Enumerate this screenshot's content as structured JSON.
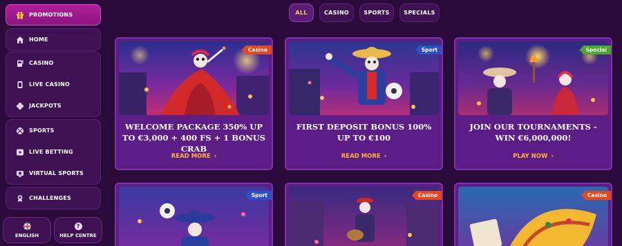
{
  "sidebar": {
    "promotions": "PROMOTIONS",
    "group1": [
      {
        "label": "HOME",
        "icon": "home-icon"
      }
    ],
    "group2": [
      {
        "label": "CASINO",
        "icon": "slot-machine-icon"
      },
      {
        "label": "LIVE CASINO",
        "icon": "card-icon"
      },
      {
        "label": "JACKPOTS",
        "icon": "clover-icon"
      }
    ],
    "group3": [
      {
        "label": "SPORTS",
        "icon": "ball-icon"
      },
      {
        "label": "LIVE BETTING",
        "icon": "play-icon"
      },
      {
        "label": "VIRTUAL SPORTS",
        "icon": "virtual-icon"
      }
    ],
    "group4": [
      {
        "label": "CHALLENGES",
        "icon": "trophy-icon"
      }
    ],
    "language": "ENGLISH",
    "help": "HELP CENTRE"
  },
  "tabs": [
    "ALL",
    "CASINO",
    "SPORTS",
    "SPECIALS"
  ],
  "cards": [
    {
      "badge": "Casino",
      "badge_color": "#e8461f",
      "title": "WELCOME PACKAGE 350% UP TO €3,000 + 400 FS + 1 BONUS CRAB",
      "cta": "READ MORE"
    },
    {
      "badge": "Sport",
      "badge_color": "#2f4fc4",
      "title": "FIRST DEPOSIT BONUS 100% UP TO €100",
      "cta": "READ MORE"
    },
    {
      "badge": "Special",
      "badge_color": "#4aa82a",
      "title": "JOIN OUR TOURNAMENTS - WIN €6,000,000!",
      "cta": "PLAY NOW"
    },
    {
      "badge": "Sport",
      "badge_color": "#2f4fc4"
    },
    {
      "badge": "Casino",
      "badge_color": "#e8461f"
    },
    {
      "badge": "Casino",
      "badge_color": "#e8461f"
    }
  ],
  "colors": {
    "background": "#2a0a3a",
    "accent": "#ffb23a",
    "active_tab_text": "#ffd43a"
  }
}
